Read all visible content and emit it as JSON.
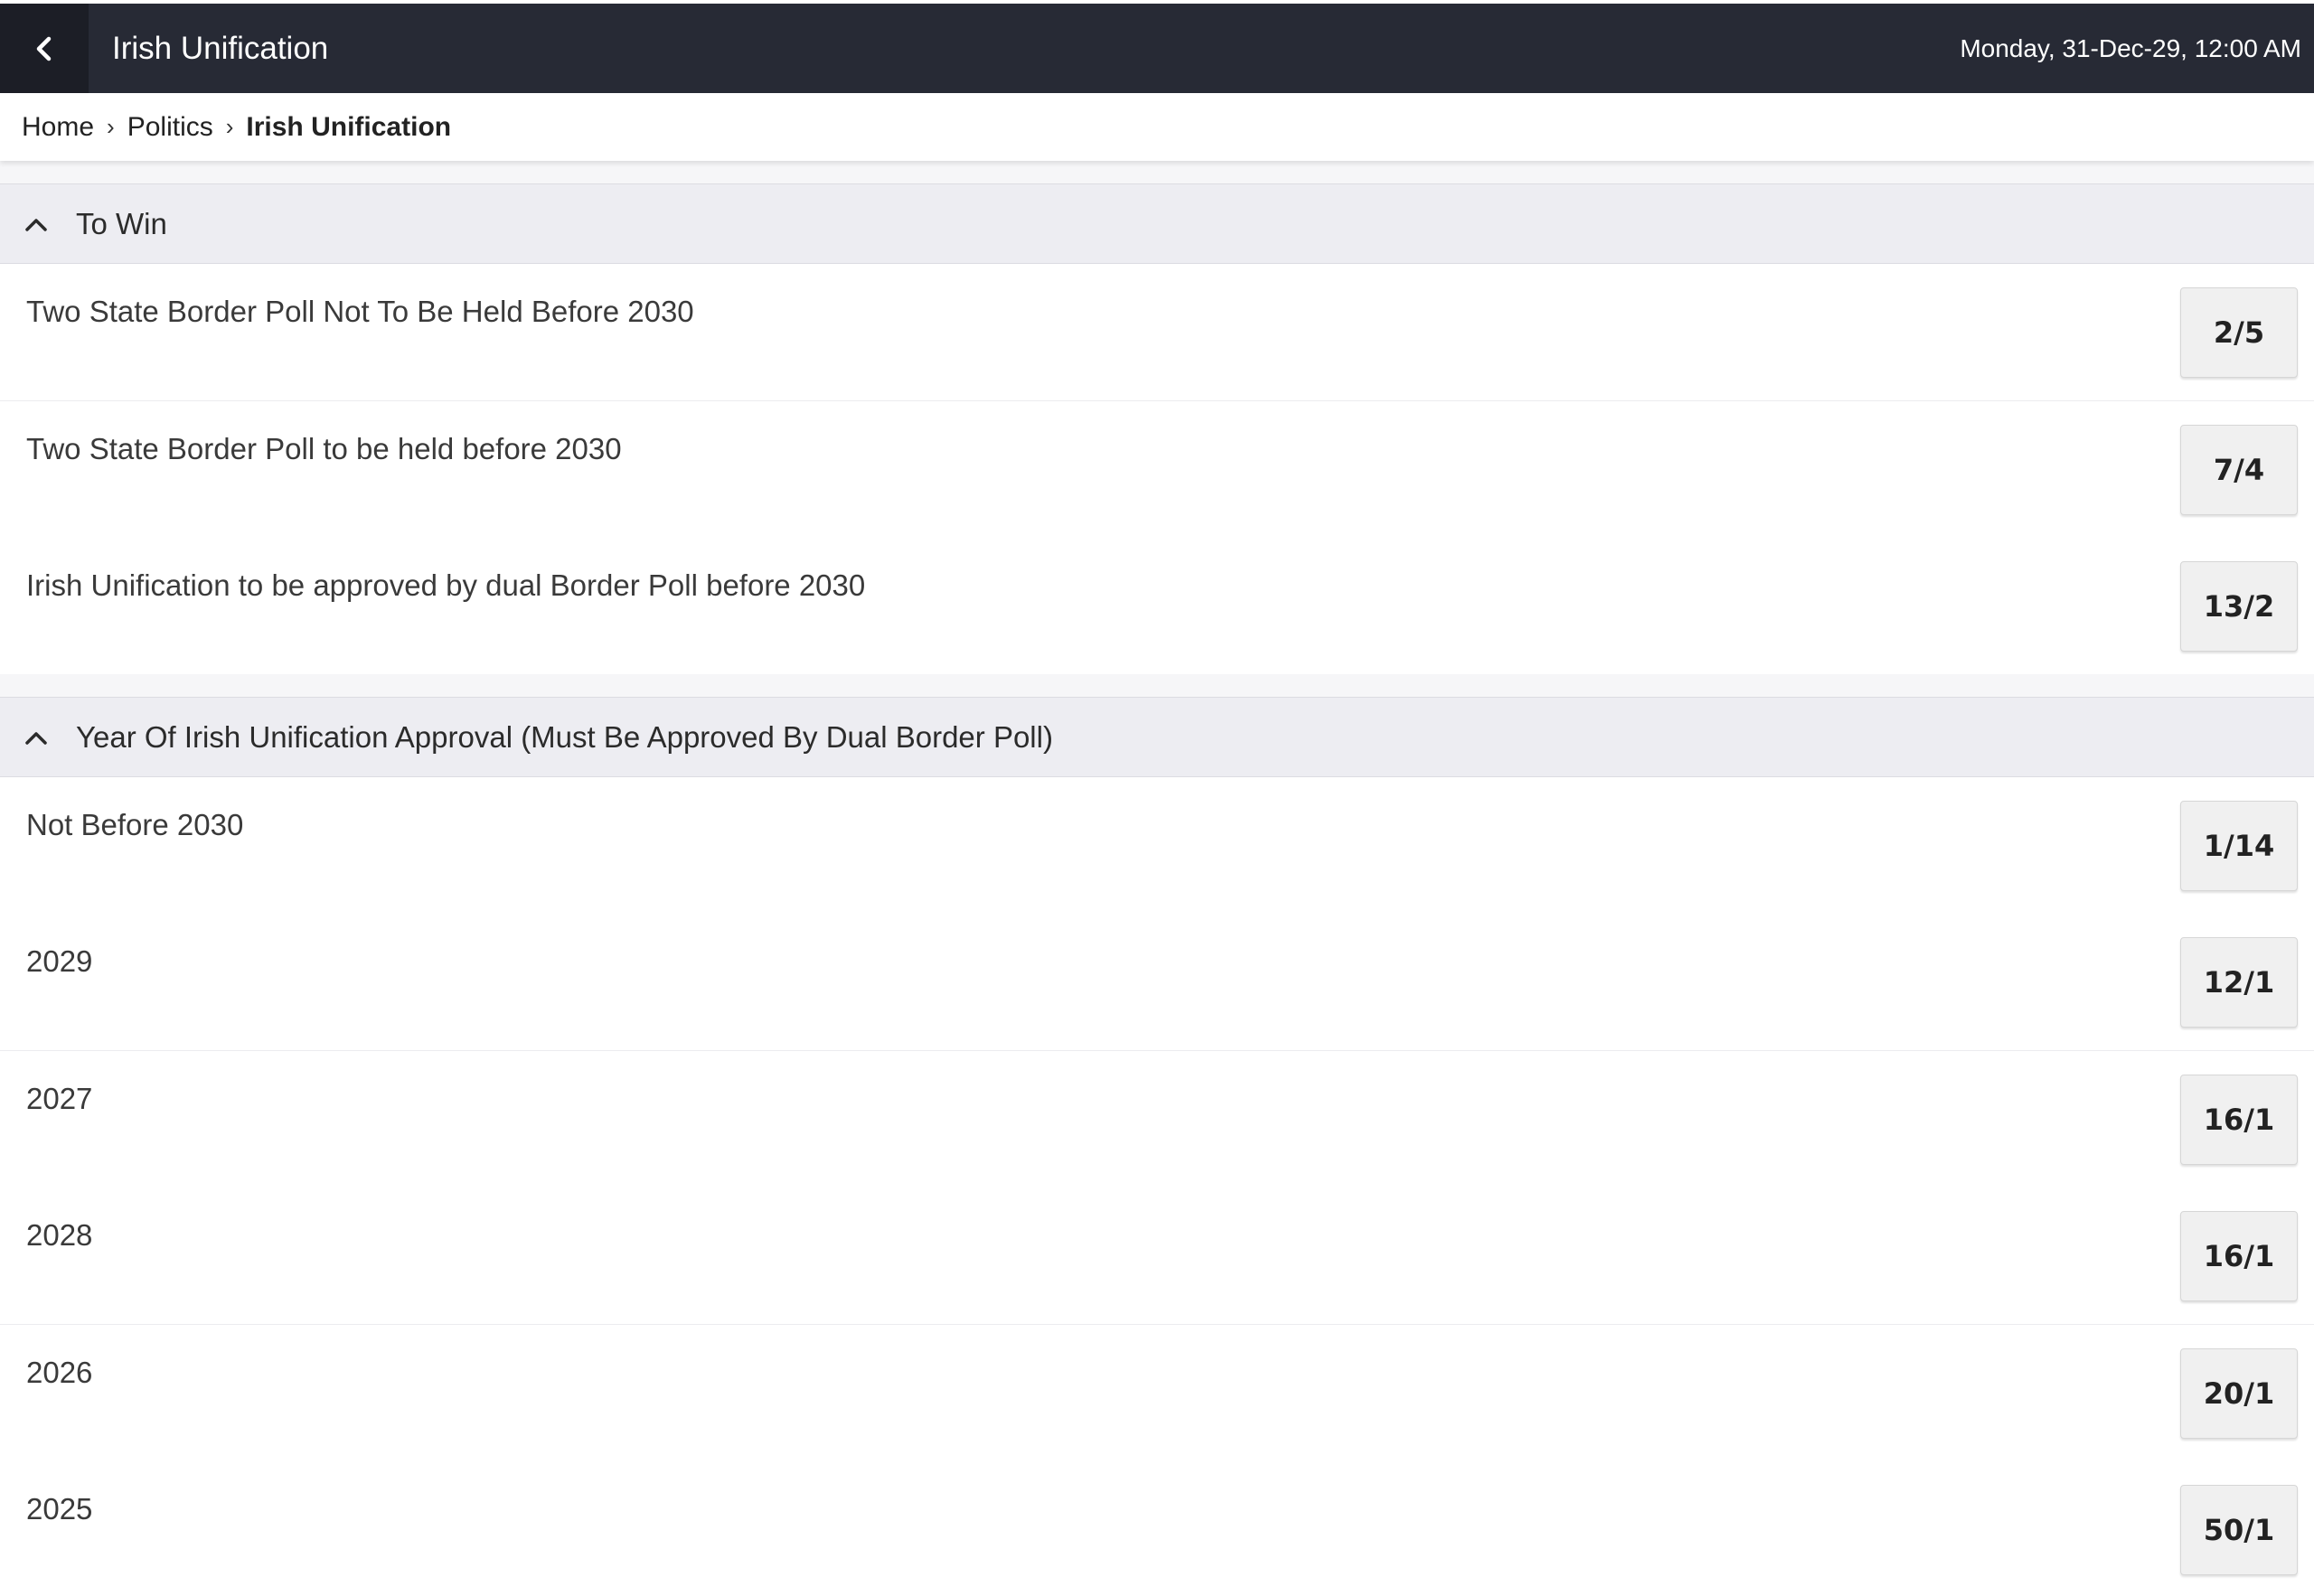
{
  "header": {
    "title": "Irish Unification",
    "datetime": "Monday, 31-Dec-29, 12:00 AM",
    "back_icon": "chevron-left-icon"
  },
  "breadcrumb": {
    "items": [
      "Home",
      "Politics",
      "Irish Unification"
    ],
    "separator": "›"
  },
  "sections": [
    {
      "title": "To Win",
      "icon": "chevron-up-icon",
      "selections": [
        {
          "label": "Two State Border Poll Not To Be Held Before 2030",
          "odds": "2/5"
        },
        {
          "label": "Two State Border Poll to be held before 2030",
          "odds": "7/4"
        },
        {
          "label": "Irish Unification to be approved by dual Border Poll before 2030",
          "odds": "13/2"
        }
      ]
    },
    {
      "title": "Year Of Irish Unification Approval (Must Be Approved By Dual Border Poll)",
      "icon": "chevron-up-icon",
      "selections": [
        {
          "label": "Not Before 2030",
          "odds": "1/14"
        },
        {
          "label": "2029",
          "odds": "12/1"
        },
        {
          "label": "2027",
          "odds": "16/1"
        },
        {
          "label": "2028",
          "odds": "16/1"
        },
        {
          "label": "2026",
          "odds": "20/1"
        },
        {
          "label": "2025",
          "odds": "50/1"
        }
      ]
    }
  ],
  "colors": {
    "topbar": "#272a35",
    "back_button": "#1c1e26",
    "section_header": "#ededf2",
    "odds_button": "#f0f0f0"
  }
}
